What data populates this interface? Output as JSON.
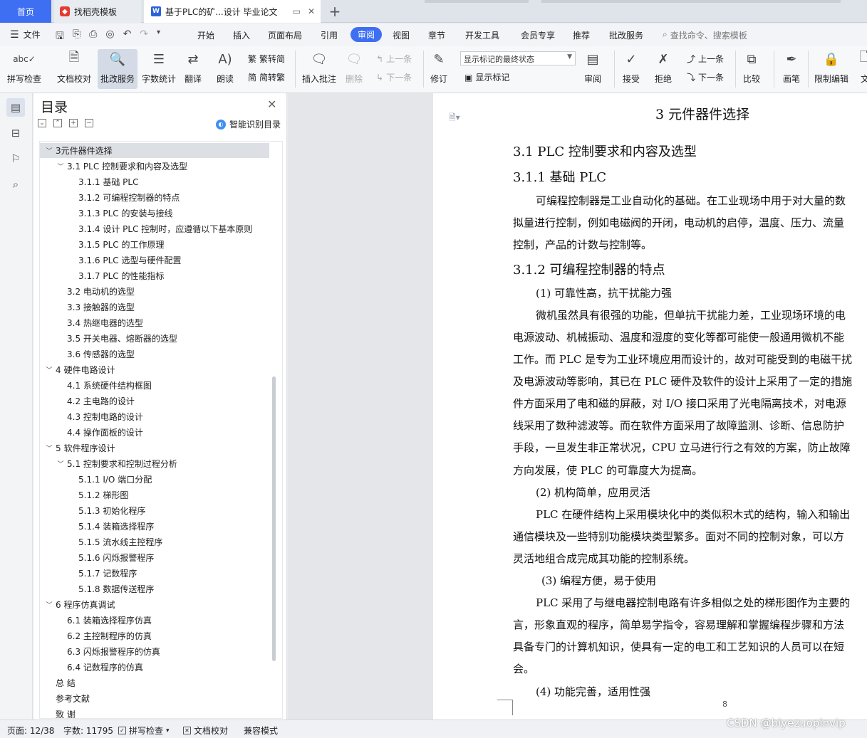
{
  "tabs": {
    "home": "首页",
    "template": "找稻壳模板",
    "document": "基于PLC的矿...设计 毕业论文",
    "add": "+"
  },
  "menubar": {
    "file": "文件",
    "items": [
      "开始",
      "插入",
      "页面布局",
      "引用",
      "审阅",
      "视图",
      "章节",
      "开发工具",
      "会员专享",
      "推荐",
      "批改服务"
    ],
    "active": "审阅",
    "search": "查找命令、搜索模板"
  },
  "ribbon": {
    "spell": "拼写检查",
    "proof": "文档校对",
    "review_service": "批改服务",
    "wordcount": "字数统计",
    "translate": "翻译",
    "read": "朗读",
    "trad": "繁转简",
    "simp": "简转繁",
    "insert_comment": "插入批注",
    "delete": "删除",
    "prev": "上一条",
    "next": "下一条",
    "revise": "修订",
    "markup_state": "显示标记的最终状态",
    "show_markup": "显示标记",
    "review": "审阅",
    "accept": "接受",
    "reject": "拒绝",
    "prev2": "上一条",
    "next2": "下一条",
    "compare": "比较",
    "pen": "画笔",
    "restrict": "限制编辑",
    "doc_cut": "文"
  },
  "toc": {
    "title": "目录",
    "smart": "智能识别目录",
    "items": [
      {
        "label": "3元件器件选择",
        "level": 0,
        "chev": "﹀"
      },
      {
        "label": "3.1 PLC 控制要求和内容及选型",
        "level": 1,
        "chev": "﹀"
      },
      {
        "label": "3.1.1 基础 PLC",
        "level": 2,
        "chev": ""
      },
      {
        "label": "3.1.2 可编程控制器的特点",
        "level": 2,
        "chev": ""
      },
      {
        "label": "3.1.3 PLC 的安装与接线",
        "level": 2,
        "chev": ""
      },
      {
        "label": "3.1.4 设计 PLC 控制时，应遵循以下基本原则",
        "level": 2,
        "chev": ""
      },
      {
        "label": "3.1.5 PLC 的工作原理",
        "level": 2,
        "chev": ""
      },
      {
        "label": "3.1.6 PLC 选型与硬件配置",
        "level": 2,
        "chev": ""
      },
      {
        "label": "3.1.7 PLC 的性能指标",
        "level": 2,
        "chev": ""
      },
      {
        "label": "3.2 电动机的选型",
        "level": 1,
        "chev": ""
      },
      {
        "label": "3.3 接触器的选型",
        "level": 1,
        "chev": ""
      },
      {
        "label": "3.4 热继电器的选型",
        "level": 1,
        "chev": ""
      },
      {
        "label": "3.5 开关电器、熔断器的选型",
        "level": 1,
        "chev": ""
      },
      {
        "label": "3.6 传感器的选型",
        "level": 1,
        "chev": ""
      },
      {
        "label": "4  硬件电路设计",
        "level": 0,
        "chev": "﹀"
      },
      {
        "label": "4.1 系统硬件结构框图",
        "level": 1,
        "chev": ""
      },
      {
        "label": "4.2 主电路的设计",
        "level": 1,
        "chev": ""
      },
      {
        "label": "4.3 控制电路的设计",
        "level": 1,
        "chev": ""
      },
      {
        "label": "4.4 操作面板的设计",
        "level": 1,
        "chev": ""
      },
      {
        "label": "5  软件程序设计",
        "level": 0,
        "chev": "﹀"
      },
      {
        "label": "5.1 控制要求和控制过程分析",
        "level": 1,
        "chev": "﹀"
      },
      {
        "label": "5.1.1 I/O 端口分配",
        "level": 2,
        "chev": ""
      },
      {
        "label": "5.1.2 梯形图",
        "level": 2,
        "chev": ""
      },
      {
        "label": "5.1.3 初始化程序",
        "level": 2,
        "chev": ""
      },
      {
        "label": "5.1.4 装箱选择程序",
        "level": 2,
        "chev": ""
      },
      {
        "label": "5.1.5 流水线主控程序",
        "level": 2,
        "chev": ""
      },
      {
        "label": "5.1.6 闪烁报警程序",
        "level": 2,
        "chev": ""
      },
      {
        "label": "5.1.7 记数程序",
        "level": 2,
        "chev": ""
      },
      {
        "label": "5.1.8 数据传送程序",
        "level": 2,
        "chev": ""
      },
      {
        "label": "6  程序仿真调试",
        "level": 0,
        "chev": "﹀"
      },
      {
        "label": "6.1 装箱选择程序仿真",
        "level": 1,
        "chev": ""
      },
      {
        "label": "6.2 主控制程序的仿真",
        "level": 1,
        "chev": ""
      },
      {
        "label": "6.3 闪烁报警程序的仿真",
        "level": 1,
        "chev": ""
      },
      {
        "label": "6.4 记数程序的仿真",
        "level": 1,
        "chev": ""
      },
      {
        "label": "总   结",
        "level": 0,
        "chev": ""
      },
      {
        "label": "参考文献",
        "level": 0,
        "chev": ""
      },
      {
        "label": "致   谢",
        "level": 0,
        "chev": ""
      }
    ]
  },
  "document": {
    "h1": "3   元件器件选择",
    "h2_1": "3.1 PLC 控制要求和内容及选型",
    "h2_2": "3.1.1 基础 PLC",
    "p1": "可编程控制器是工业自动化的基础。在工业现场中用于对大量的数",
    "p2": "拟量进行控制，例如电磁阀的开闭，电动机的启停，温度、压力、流量",
    "p3": "控制，产品的计数与控制等。",
    "h2_3": "3.1.2 可编程控制器的特点",
    "i1": "(1)  可靠性高，抗干扰能力强",
    "p4": "微机虽然具有很强的功能，但单抗干扰能力差，工业现场环境的电",
    "p5": "电源波动、机械振动、温度和湿度的变化等都可能使一般通用微机不能",
    "p6": "工作。而 PLC 是专为工业环境应用而设计的，故对可能受到的电磁干扰",
    "p7": "及电源波动等影响，其已在 PLC 硬件及软件的设计上采用了一定的措施",
    "p8": "件方面采用了电和磁的屏蔽，对 I/O 接口采用了光电隔离技术，对电源",
    "p9": "线采用了数种滤波等。而在软件方面采用了故障监测、诊断、信息防护",
    "p10": "手段，一旦发生非正常状况，CPU 立马进行行之有效的方案，防止故障",
    "p11": "方向发展，使 PLC 的可靠度大为提高。",
    "i2": "(2)  机构简单，应用灵活",
    "p12": "PLC 在硬件结构上采用模块化中的类似积木式的结构，输入和输出",
    "p13": "通信模块及一些特别功能模块类型繁多。面对不同的控制对象，可以方",
    "p14": "灵活地组合成完成其功能的控制系统。",
    "i3": "(3)  编程方便，易于使用",
    "p15": "PLC 采用了与继电器控制电路有许多相似之处的梯形图作为主要的",
    "p16": "言，形象直观的程序，简单易学指令，容易理解和掌握编程步骤和方法",
    "p17": "具备专门的计算机知识，使具有一定的电工和工艺知识的人员可以在短",
    "p18": "会。",
    "i4": "(4)  功能完善，适用性强",
    "pageno": "8"
  },
  "statusbar": {
    "page": "页面: 12/38",
    "words": "字数: 11795",
    "spell": "拼写检查",
    "proof": "文档校对",
    "compat": "兼容模式"
  },
  "watermark": "CSDN @biyezuopinvip",
  "colors": {
    "accent": "#3e6ff3",
    "tab_bg": "#dfe3ea",
    "ribbon_bg": "#f7f8fa",
    "page_bg": "#ffffff"
  }
}
